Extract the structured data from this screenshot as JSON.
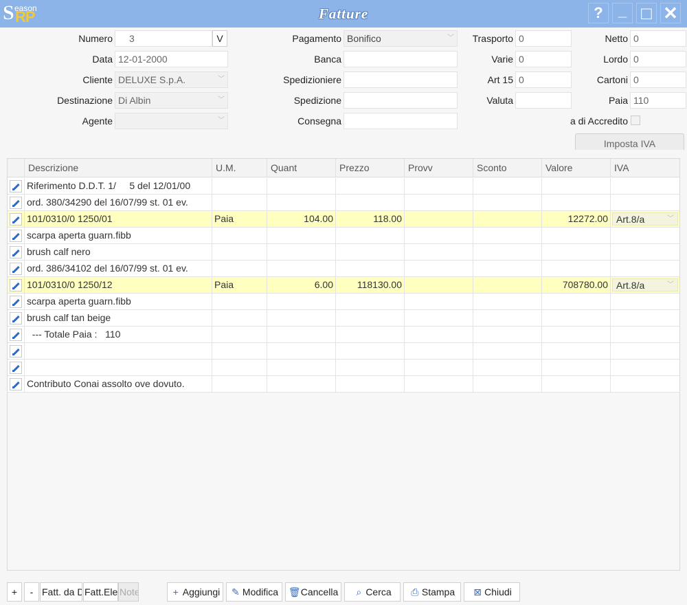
{
  "window": {
    "title": "Fatture",
    "logo_s": "S",
    "logo_eason": "eason",
    "logo_rp": "RP",
    "help": "?",
    "minimize": "_",
    "maximize": "□",
    "close": "✕"
  },
  "form": {
    "numero": {
      "label": "Numero",
      "value": "3",
      "button": "V"
    },
    "data": {
      "label": "Data",
      "value": "12-01-2000"
    },
    "cliente": {
      "label": "Cliente",
      "value": "DELUXE S.p.A."
    },
    "destinazione": {
      "label": "Destinazione",
      "value": "Di Albin"
    },
    "agente": {
      "label": "Agente",
      "value": ""
    },
    "pagamento": {
      "label": "Pagamento",
      "value": "Bonifico"
    },
    "banca": {
      "label": "Banca",
      "value": ""
    },
    "spedizioniere": {
      "label": "Spedizioniere",
      "value": ""
    },
    "spedizione": {
      "label": "Spedizione",
      "value": ""
    },
    "consegna": {
      "label": "Consegna",
      "value": ""
    },
    "trasporto": {
      "label": "Trasporto",
      "value": "0"
    },
    "varie": {
      "label": "Varie",
      "value": "0"
    },
    "art15": {
      "label": "Art 15",
      "value": "0"
    },
    "valuta": {
      "label": "Valuta",
      "value": ""
    },
    "netto": {
      "label": "Netto",
      "value": "0"
    },
    "lordo": {
      "label": "Lordo",
      "value": "0"
    },
    "cartoni": {
      "label": "Cartoni",
      "value": "0"
    },
    "paia": {
      "label": "Paia",
      "value": "110"
    },
    "accredito": {
      "label": "a di Accredito"
    },
    "imposta_iva": "Imposta IVA"
  },
  "grid": {
    "columns": [
      "Descrizione",
      "U.M.",
      "Quant",
      "Prezzo",
      "Provv",
      "Sconto",
      "Valore",
      "IVA"
    ],
    "rows": [
      {
        "desc": "Riferimento D.D.T. 1/     5 del 12/01/00",
        "um": "",
        "quant": "",
        "prezzo": "",
        "provv": "",
        "sconto": "",
        "valore": "",
        "iva": ""
      },
      {
        "desc": "ord. 380/34290 del 16/07/99 st. 01 ev.",
        "um": "",
        "quant": "",
        "prezzo": "",
        "provv": "",
        "sconto": "",
        "valore": "",
        "iva": ""
      },
      {
        "desc": "101/0310/0 1250/01",
        "um": "Paia",
        "quant": "104.00",
        "prezzo": "118.00",
        "provv": "",
        "sconto": "",
        "valore": "12272.00",
        "iva": "Art.8/a",
        "highlight": true
      },
      {
        "desc": "scarpa aperta guarn.fibb",
        "um": "",
        "quant": "",
        "prezzo": "",
        "provv": "",
        "sconto": "",
        "valore": "",
        "iva": ""
      },
      {
        "desc": "brush calf nero",
        "um": "",
        "quant": "",
        "prezzo": "",
        "provv": "",
        "sconto": "",
        "valore": "",
        "iva": ""
      },
      {
        "desc": "ord. 386/34102 del 16/07/99 st. 01 ev.",
        "um": "",
        "quant": "",
        "prezzo": "",
        "provv": "",
        "sconto": "",
        "valore": "",
        "iva": ""
      },
      {
        "desc": "101/0310/0 1250/12",
        "um": "Paia",
        "quant": "6.00",
        "prezzo": "118130.00",
        "provv": "",
        "sconto": "",
        "valore": "708780.00",
        "iva": "Art.8/a",
        "highlight": true
      },
      {
        "desc": "scarpa aperta guarn.fibb",
        "um": "",
        "quant": "",
        "prezzo": "",
        "provv": "",
        "sconto": "",
        "valore": "",
        "iva": ""
      },
      {
        "desc": "brush calf tan beige",
        "um": "",
        "quant": "",
        "prezzo": "",
        "provv": "",
        "sconto": "",
        "valore": "",
        "iva": ""
      },
      {
        "desc": "  --- Totale Paia :   110",
        "um": "",
        "quant": "",
        "prezzo": "",
        "provv": "",
        "sconto": "",
        "valore": "",
        "iva": ""
      },
      {
        "desc": "",
        "um": "",
        "quant": "",
        "prezzo": "",
        "provv": "",
        "sconto": "",
        "valore": "",
        "iva": ""
      },
      {
        "desc": "",
        "um": "",
        "quant": "",
        "prezzo": "",
        "provv": "",
        "sconto": "",
        "valore": "",
        "iva": ""
      },
      {
        "desc": "Contributo Conai assolto ove dovuto.",
        "um": "",
        "quant": "",
        "prezzo": "",
        "provv": "",
        "sconto": "",
        "valore": "",
        "iva": ""
      }
    ]
  },
  "footer": {
    "plus": "+",
    "minus": "-",
    "fatt_da_d": "Fatt. da D",
    "fatt_elet": "Fatt.Elet",
    "note": "Note",
    "aggiungi": "Aggiungi",
    "modifica": "Modifica",
    "cancella": "Cancella",
    "cerca": "Cerca",
    "stampa": "Stampa",
    "chiudi": "Chiudi"
  },
  "colors": {
    "titlebar": "#8cb4e8",
    "highlight_row": "#ffffbf",
    "accent": "#3a6fc2"
  }
}
